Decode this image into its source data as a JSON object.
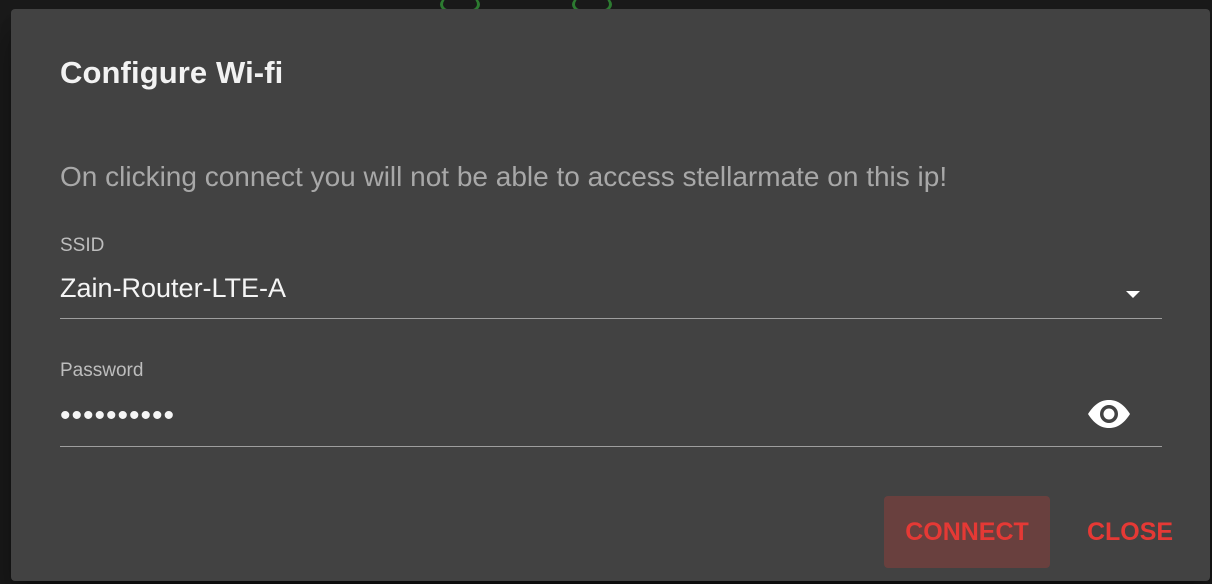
{
  "dialog": {
    "title": "Configure Wi-fi",
    "warning": "On clicking connect you will not be able to access stellarmate on this ip!"
  },
  "ssid": {
    "label": "SSID",
    "value": "Zain-Router-LTE-A",
    "icon": "dropdown-arrow"
  },
  "password": {
    "label": "Password",
    "value": "••••••••••",
    "toggle_icon": "eye-icon"
  },
  "actions": {
    "connect_label": "CONNECT",
    "close_label": "CLOSE"
  },
  "colors": {
    "dialog_bg": "#424242",
    "accent": "#e53935",
    "connect_bg": "#69403e"
  }
}
